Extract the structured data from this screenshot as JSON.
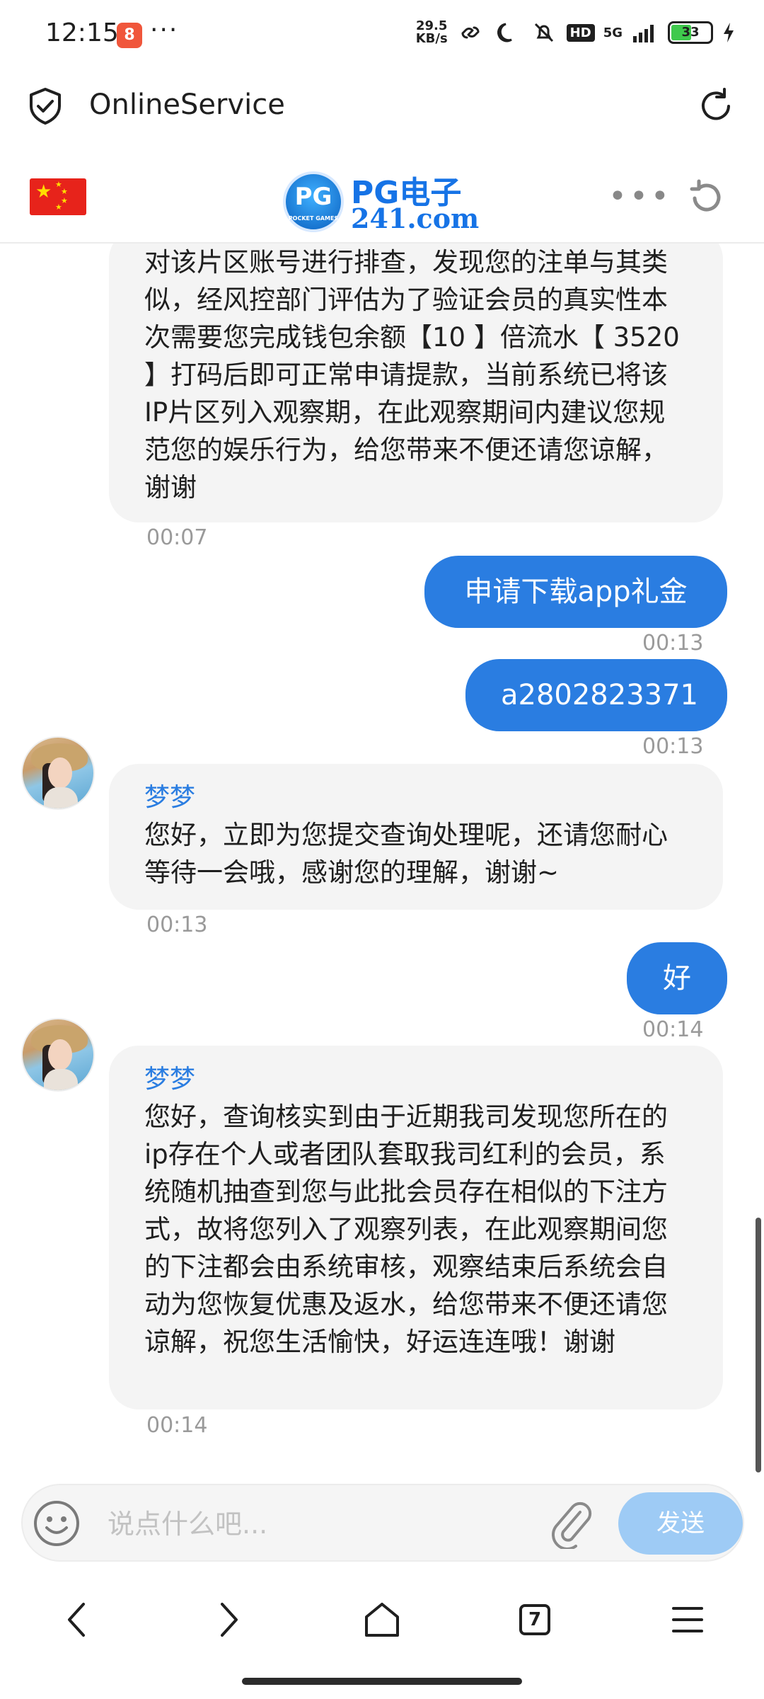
{
  "status_bar": {
    "time": "12:15",
    "more": "···",
    "app_badge": "8",
    "net_speed_value": "29.5",
    "net_speed_unit": "KB/s",
    "hd": "HD",
    "network": "5G",
    "battery": "33"
  },
  "browser": {
    "title": "OnlineService"
  },
  "site_header": {
    "logo_top": "PG电子",
    "logo_bottom": "241.com",
    "logo_badge": "PG",
    "logo_badge_sub": "POCKET GAMES",
    "more": "•••"
  },
  "chat": {
    "messages": [
      {
        "side": "in",
        "text": "对该片区账号进行排查，发现您的注单与其类似，经风控部门评估为了验证会员的真实性本次需要您完成钱包余额【10 】倍流水【 3520 】打码后即可正常申请提款，当前系统已将该IP片区列入观察期，在此观察期间内建议您规范您的娱乐行为，给您带来不便还请您谅解，谢谢",
        "time": "00:07"
      },
      {
        "side": "out",
        "text": "申请下载app礼金",
        "time": "00:13"
      },
      {
        "side": "out",
        "text": "a2802823371",
        "time": "00:13"
      },
      {
        "side": "in",
        "sender": "梦梦",
        "text": "您好，立即为您提交查询处理呢，还请您耐心等待一会哦，感谢您的理解，谢谢~",
        "time": "00:13"
      },
      {
        "side": "out",
        "text": "好",
        "time": "00:14"
      },
      {
        "side": "in",
        "sender": "梦梦",
        "text": "您好，查询核实到由于近期我司发现您所在的ip存在个人或者团队套取我司红利的会员，系统随机抽查到您与此批会员存在相似的下注方式，故将您列入了观察列表，在此观察期间您的下注都会由系统审核，观察结束后系统会自动为您恢复优惠及返水，给您带来不便还请您谅解，祝您生活愉快，好运连连哦！谢谢",
        "time": "00:14"
      }
    ]
  },
  "composer": {
    "placeholder": "说点什么吧...",
    "send_label": "发送"
  },
  "nav": {
    "tabs_count": "7"
  },
  "colors": {
    "accent": "#2a7de1",
    "send_disabled": "#9ecbf5",
    "incoming_bubble": "#f4f4f4"
  }
}
